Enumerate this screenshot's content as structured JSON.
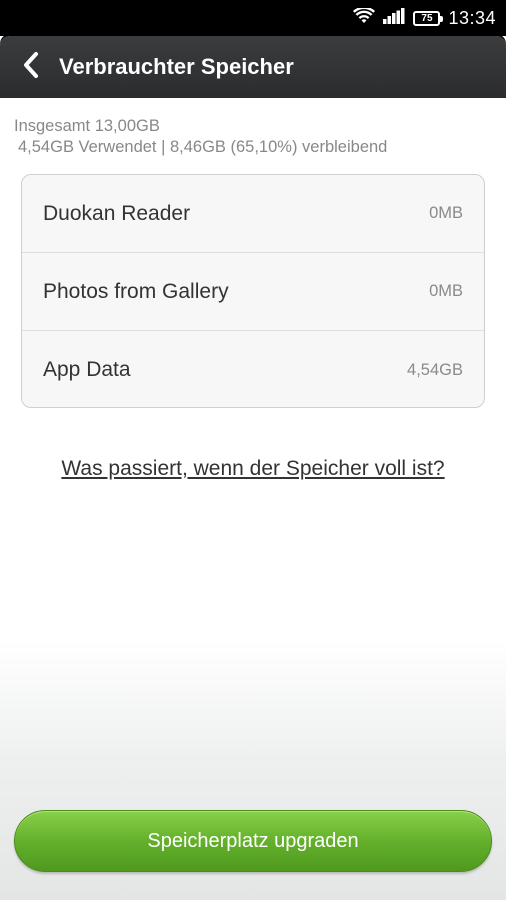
{
  "status_bar": {
    "battery_level": "75",
    "time": "13:34",
    "icons": [
      "wifi-icon",
      "signal-icon",
      "battery-icon"
    ]
  },
  "header": {
    "back_icon": "chevron-left-icon",
    "title": "Verbrauchter Speicher"
  },
  "summary": {
    "total": "Insgesamt 13,00GB",
    "usage": "4,54GB Verwendet | 8,46GB (65,10%) verbleibend"
  },
  "storage_items": [
    {
      "label": "Duokan Reader",
      "value": "0MB"
    },
    {
      "label": "Photos from Gallery",
      "value": "0MB"
    },
    {
      "label": "App Data",
      "value": "4,54GB"
    }
  ],
  "help_link": "Was passiert, wenn der Speicher voll ist?",
  "upgrade_button": "Speicherplatz upgraden",
  "colors": {
    "accent_green": "#64b02c",
    "header_bg": "#2b2c2e"
  }
}
